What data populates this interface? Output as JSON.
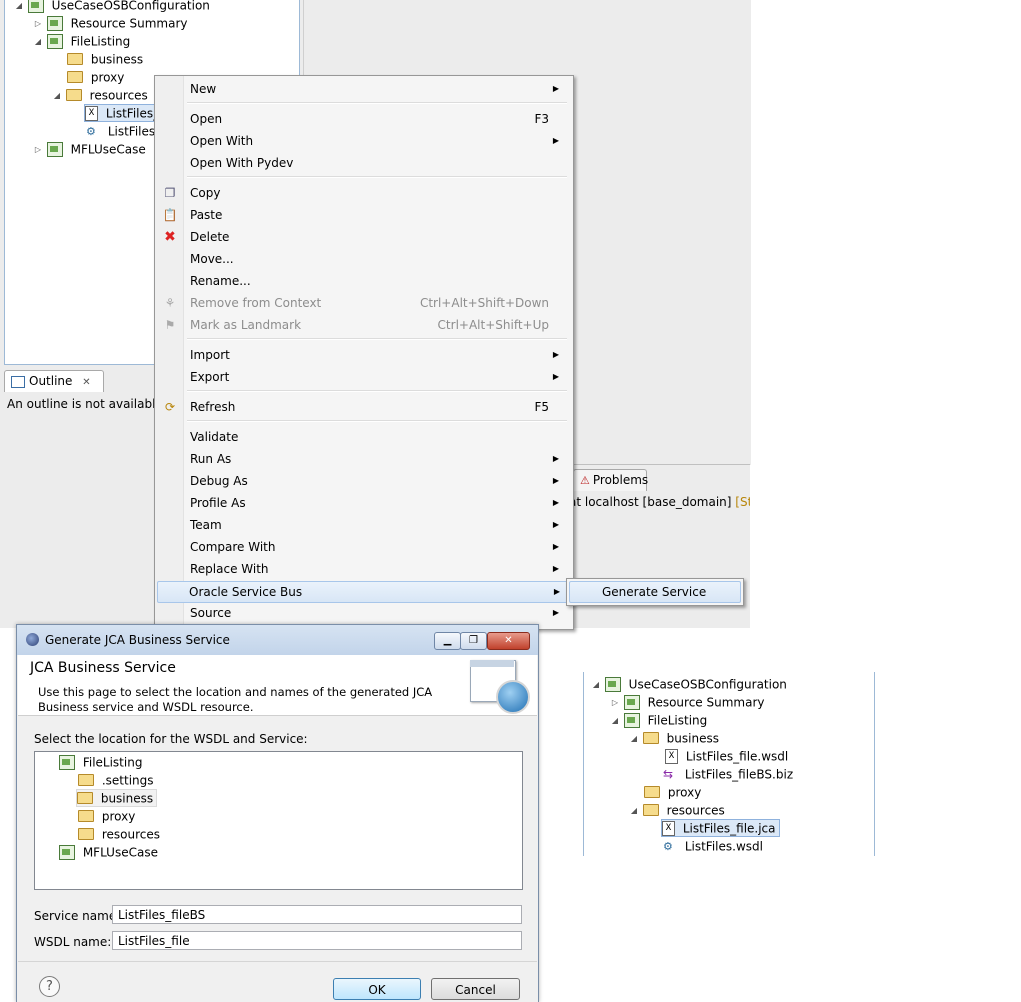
{
  "explorer": {
    "rows": [
      {
        "label": "UseCaseOSBConfiguration"
      },
      {
        "label": "Resource Summary"
      },
      {
        "label": "FileListing"
      },
      {
        "label": "business"
      },
      {
        "label": "proxy"
      },
      {
        "label": "resources"
      },
      {
        "label": "ListFiles_"
      },
      {
        "label": "ListFiles.v"
      },
      {
        "label": "MFLUseCase"
      }
    ]
  },
  "outline": {
    "tab_label": "Outline",
    "message": "An outline is not available."
  },
  "bottom_panel": {
    "problems_tab": "Problems",
    "server_text": "at localhost [base_domain]",
    "server_status": "[Starte"
  },
  "context_menu": {
    "items": [
      {
        "label": "New"
      },
      {
        "label": "Open",
        "accel": "F3"
      },
      {
        "label": "Open With"
      },
      {
        "label": "Open With Pydev"
      },
      {
        "label": "Copy"
      },
      {
        "label": "Paste"
      },
      {
        "label": "Delete"
      },
      {
        "label": "Move..."
      },
      {
        "label": "Rename..."
      },
      {
        "label": "Remove from Context",
        "accel": "Ctrl+Alt+Shift+Down"
      },
      {
        "label": "Mark as Landmark",
        "accel": "Ctrl+Alt+Shift+Up"
      },
      {
        "label": "Import"
      },
      {
        "label": "Export"
      },
      {
        "label": "Refresh",
        "accel": "F5"
      },
      {
        "label": "Validate"
      },
      {
        "label": "Run As"
      },
      {
        "label": "Debug As"
      },
      {
        "label": "Profile As"
      },
      {
        "label": "Team"
      },
      {
        "label": "Compare With"
      },
      {
        "label": "Replace With"
      },
      {
        "label": "Oracle Service Bus"
      },
      {
        "label": "Source"
      }
    ],
    "submenu": {
      "label": "Generate Service"
    }
  },
  "dialog": {
    "title": "Generate JCA Business Service",
    "heading": "JCA Business Service",
    "description": "Use this page to select the location and names of the generated JCA Business service and WSDL resource.",
    "location_label": "Select the location for the WSDL and Service:",
    "tree": [
      {
        "label": "FileListing"
      },
      {
        "label": ".settings"
      },
      {
        "label": "business"
      },
      {
        "label": "proxy"
      },
      {
        "label": "resources"
      },
      {
        "label": "MFLUseCase"
      }
    ],
    "service_name_label": "Service name:",
    "service_name_value": "ListFiles_fileBS",
    "wsdl_name_label": "WSDL name:",
    "wsdl_name_value": "ListFiles_file",
    "ok_label": "OK",
    "cancel_label": "Cancel",
    "help_glyph": "?"
  },
  "result_tree": {
    "rows": [
      {
        "label": "UseCaseOSBConfiguration"
      },
      {
        "label": "Resource Summary"
      },
      {
        "label": "FileListing"
      },
      {
        "label": "business"
      },
      {
        "label": "ListFiles_file.wsdl"
      },
      {
        "label": "ListFiles_fileBS.biz"
      },
      {
        "label": "proxy"
      },
      {
        "label": "resources"
      },
      {
        "label": "ListFiles_file.jca"
      },
      {
        "label": "ListFiles.wsdl"
      }
    ]
  }
}
